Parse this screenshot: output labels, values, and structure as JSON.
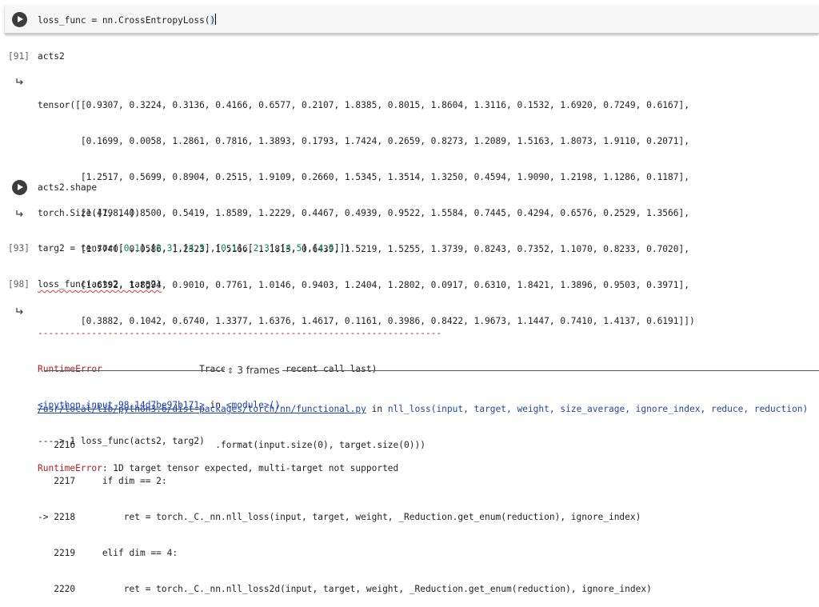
{
  "cells": {
    "c1": {
      "code_before": "loss_func = nn.CrossEntropyLoss(",
      "code_paren": ")"
    },
    "c2": {
      "prompt": "[91]",
      "code": "acts2",
      "output_lines": [
        "tensor([[0.9307, 0.3224, 0.3136, 0.4166, 0.6577, 0.2107, 1.8385, 0.8015, 1.8604, 1.3116, 0.1532, 1.6920, 0.7249, 0.6167],",
        "        [0.1699, 0.0058, 1.2861, 0.7816, 1.3893, 0.1793, 1.7424, 0.2659, 0.8273, 1.2089, 1.5163, 1.8073, 1.9110, 0.2071],",
        "        [1.2517, 0.5699, 0.8904, 0.2515, 1.9109, 0.2660, 1.5345, 1.3514, 1.3250, 0.4594, 1.9090, 1.2198, 1.1286, 0.1187],",
        "        [1.4198, 0.8500, 0.5419, 1.8589, 1.2229, 0.4467, 0.4939, 0.9522, 1.5584, 0.7445, 0.4294, 0.6576, 0.2529, 1.3566],",
        "        [1.7740, 0.0586, 1.2323, 1.5166, 1.1813, 0.6439, 1.5219, 1.5255, 1.3739, 0.8243, 0.7352, 1.1070, 0.8233, 0.7020],",
        "        [1.6392, 1.8594, 0.9010, 0.7761, 1.0146, 0.9403, 1.2404, 1.2802, 0.0917, 0.6310, 1.8421, 1.3896, 0.9503, 0.3971],",
        "        [0.3882, 0.1042, 0.6740, 1.3377, 1.6376, 1.4617, 0.1161, 0.3986, 0.8422, 1.9673, 1.1447, 0.7410, 1.4137, 0.6191]])"
      ]
    },
    "c3": {
      "code": "acts2.shape",
      "output": "torch.Size([7, 14])"
    },
    "c4": {
      "prompt": "[93]",
      "code_parts": [
        "targ2 = tensor([",
        "0",
        ",",
        "1",
        "],[",
        "2",
        ",",
        "3",
        "],[",
        "4",
        ",",
        "5",
        "],[",
        "0",
        ",",
        "1",
        "],[",
        "2",
        ",",
        "3",
        "],[",
        "4",
        ",",
        "5",
        "],[",
        "4",
        ",",
        "5",
        "]])"
      ]
    },
    "c5": {
      "prompt": "[98]",
      "code_fn": "loss_func",
      "code_rest": "(acts2, targ2)",
      "error": {
        "dashes": "---------------------------------------------------------------------------",
        "name": "RuntimeError",
        "traceback_header": "Traceback (most recent call last)",
        "input_link": "<ipython-input-98-14d7be97b171>",
        "in_text": " in ",
        "module": "<module>()",
        "arrow_line": "----> 1 loss_func(acts2, targ2)",
        "frames_label": "3 frames",
        "file_link": "/usr/local/lib/python3.6/dist-packages/torch/nn/functional.py",
        "file_in": " in ",
        "file_func": "nll_loss(input, target, weight, size_average, ignore_index, reduce, reduction)",
        "src_lines": [
          "   2216                          .format(input.size(0), target.size(0)))",
          "   2217     if dim == 2:",
          "-> 2218         ret = torch._C._nn.nll_loss(input, target, weight, _Reduction.get_enum(reduction), ignore_index)",
          "   2219     elif dim == 4:",
          "   2220         ret = torch._C._nn.nll_loss2d(input, target, weight, _Reduction.get_enum(reduction), ignore_index)"
        ],
        "final_name": "RuntimeError",
        "final_msg": ": 1D target tensor expected, multi-target not supported"
      }
    }
  },
  "icons": {
    "run": "play-circle-icon",
    "output": "output-arrow-icon",
    "frames": "chevron-up-down-icon"
  },
  "colors": {
    "error_red": "#b71c1c",
    "link_blue": "#1a3db8",
    "number_green": "#098658",
    "run_button": "#3c3c3c"
  }
}
